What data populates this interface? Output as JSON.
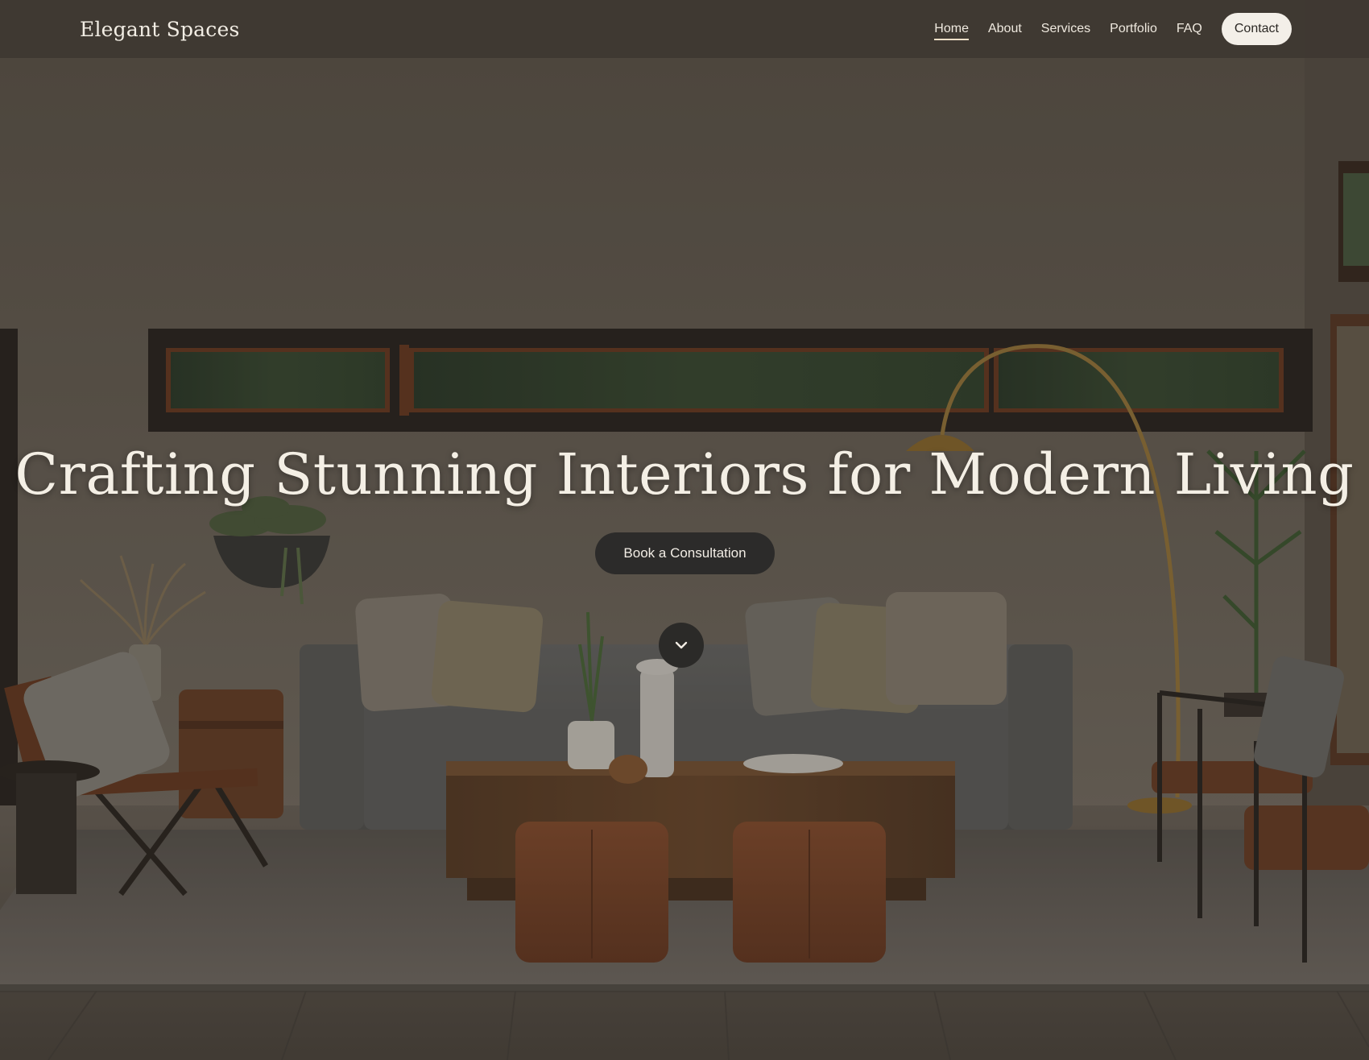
{
  "brand": {
    "name": "Elegant Spaces"
  },
  "nav": {
    "items": [
      {
        "label": "Home",
        "active": true
      },
      {
        "label": "About",
        "active": false
      },
      {
        "label": "Services",
        "active": false
      },
      {
        "label": "Portfolio",
        "active": false
      },
      {
        "label": "FAQ",
        "active": false
      }
    ],
    "cta_label": "Contact"
  },
  "hero": {
    "title": "Crafting Stunning Interiors for Modern Living",
    "cta_label": "Book a Consultation",
    "scroll_icon": "chevron-down-icon",
    "background_image": "living-room-interior"
  },
  "colors": {
    "nav_background": "#3e3832",
    "text_light": "#f4efe5",
    "cta_dark": "#2c2b2a",
    "contact_button": "#f3efe8"
  }
}
